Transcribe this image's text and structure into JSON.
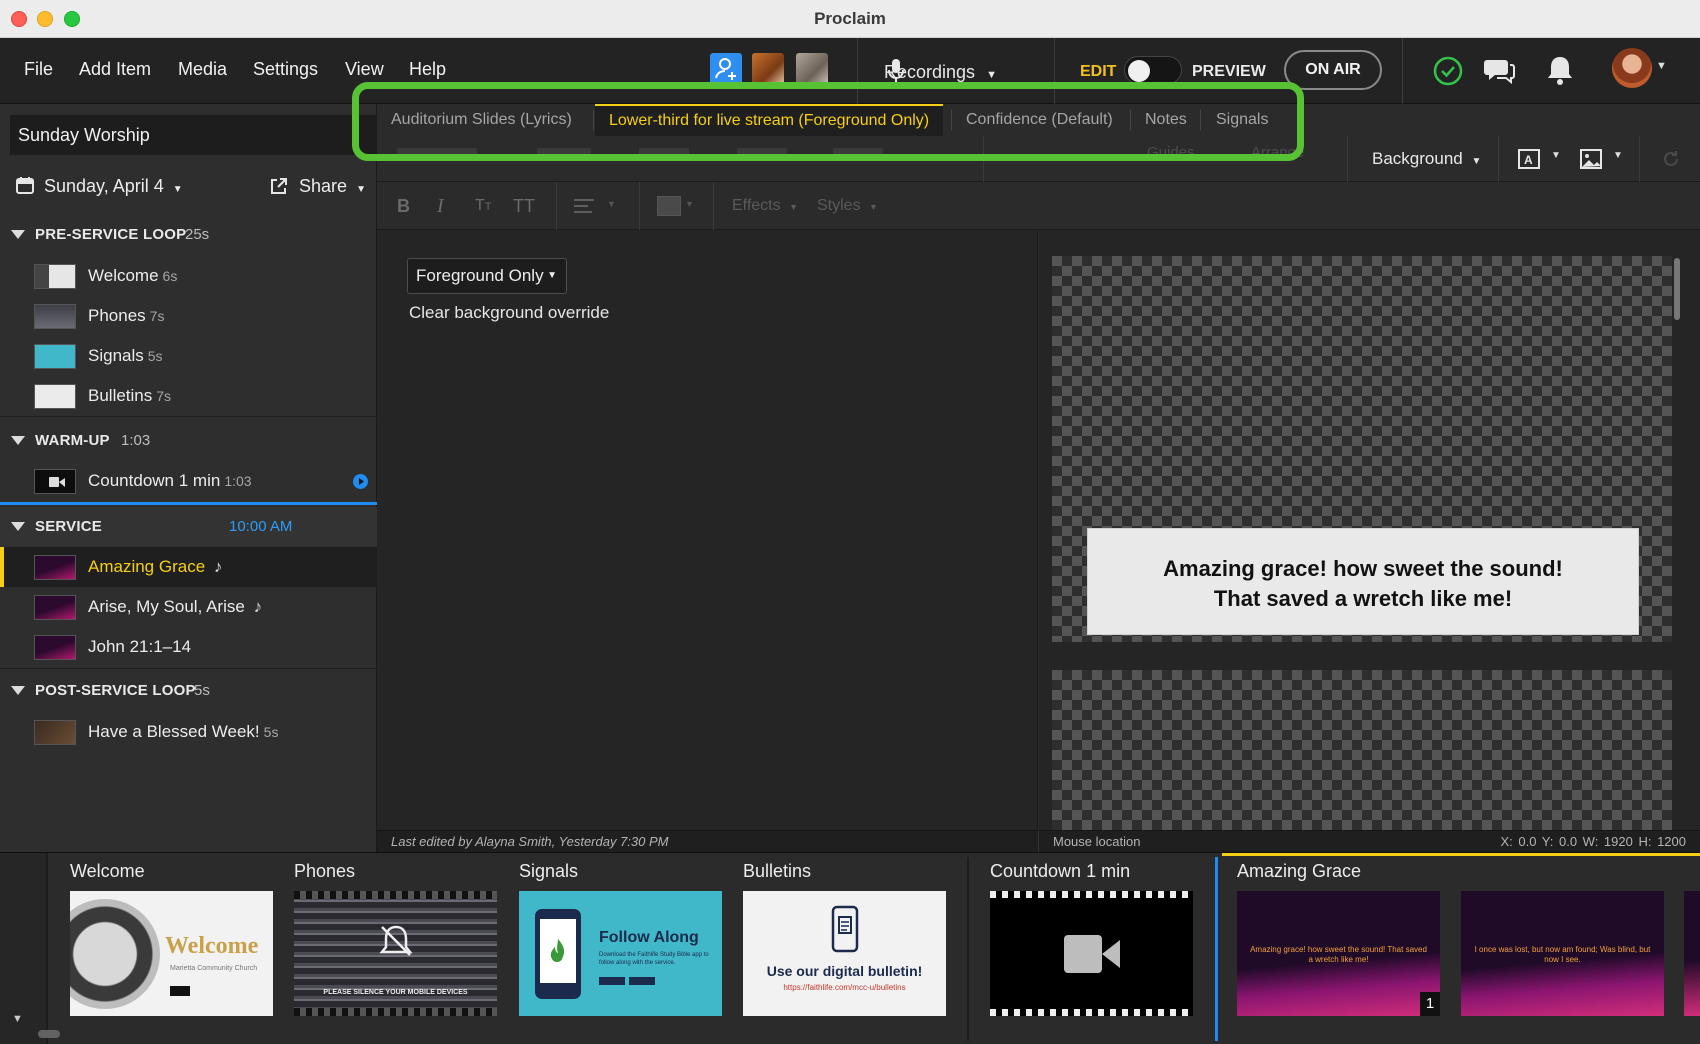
{
  "window": {
    "title": "Proclaim"
  },
  "menu": [
    "File",
    "Add Item",
    "Media",
    "Settings",
    "View",
    "Help"
  ],
  "toolbar": {
    "recordings_label": "Recordings",
    "edit_label": "EDIT",
    "preview_label": "PREVIEW",
    "onair_label": "ON AIR"
  },
  "sidebar": {
    "service_title": "Sunday Worship",
    "date_label": "Sunday, April 4",
    "share_label": "Share",
    "sections": [
      {
        "name": "PRE-SERVICE LOOP",
        "time": "25s",
        "items": [
          {
            "label": "Welcome",
            "duration": "6s"
          },
          {
            "label": "Phones",
            "duration": "7s"
          },
          {
            "label": "Signals",
            "duration": "5s"
          },
          {
            "label": "Bulletins",
            "duration": "7s"
          }
        ]
      },
      {
        "name": "WARM-UP",
        "time": "1:03",
        "items": [
          {
            "label": "Countdown 1 min",
            "duration": "1:03"
          }
        ]
      },
      {
        "name": "SERVICE",
        "time": "10:00 AM",
        "items": [
          {
            "label": "Amazing Grace",
            "note": "♪"
          },
          {
            "label": "Arise, My Soul, Arise",
            "note": "♪"
          },
          {
            "label": "John 21:1–14"
          }
        ]
      },
      {
        "name": "POST-SERVICE LOOP",
        "time": "5s",
        "items": [
          {
            "label": "Have a Blessed Week!",
            "duration": "5s"
          }
        ]
      }
    ]
  },
  "tabs": [
    "Auditorium Slides (Lyrics)",
    "Lower-third for live stream (Foreground Only)",
    "Confidence (Default)",
    "Notes",
    "Signals"
  ],
  "format_toolbar": {
    "guides_label": "Guides",
    "arrange_label": "Arrange",
    "background_label": "Background",
    "effects_label": "Effects",
    "styles_label": "Styles",
    "bold": "B",
    "italic": "I",
    "text_size": "TT"
  },
  "editor": {
    "dropdown_value": "Foreground Only",
    "clear_label": "Clear background override"
  },
  "preview": {
    "line1": "Amazing grace! how sweet the sound!",
    "line2": "That saved a wretch like me!"
  },
  "status": {
    "edited": "Last edited by Alayna Smith, Yesterday 7:30 PM",
    "mouse": "Mouse location",
    "coords": "X: 0.0  Y: 0.0    W: 1920  H: 1200"
  },
  "filmstrip": {
    "slides": [
      {
        "label": "Welcome"
      },
      {
        "label": "Phones"
      },
      {
        "label": "Signals"
      },
      {
        "label": "Bulletins"
      },
      {
        "label": "Countdown 1 min"
      },
      {
        "label": "Amazing Grace"
      }
    ],
    "welcome_thumb_title": "Welcome",
    "welcome_thumb_sub": "Marietta Community Church",
    "phones_thumb_text": "PLEASE SILENCE YOUR MOBILE DEVICES",
    "signals_thumb_title": "Follow Along",
    "signals_thumb_sub": "Download the Faithlife Study Bible app to follow along with the service.",
    "bulletin_thumb_title": "Use our digital bulletin!",
    "bulletin_thumb_url": "https://faithlife.com/mcc-u/bulletins",
    "amazing_slide1_text": "Amazing grace! how sweet the sound! That saved a wretch like me!",
    "amazing_slide1_number": "1",
    "amazing_slide2_text": "I once was lost, but now am found; Was blind, but now I see."
  },
  "colors": {
    "accent_yellow": "#f5cf14",
    "highlight_green": "#58c235",
    "active_blue": "#1e8cf0",
    "status_green": "#33c24a"
  }
}
